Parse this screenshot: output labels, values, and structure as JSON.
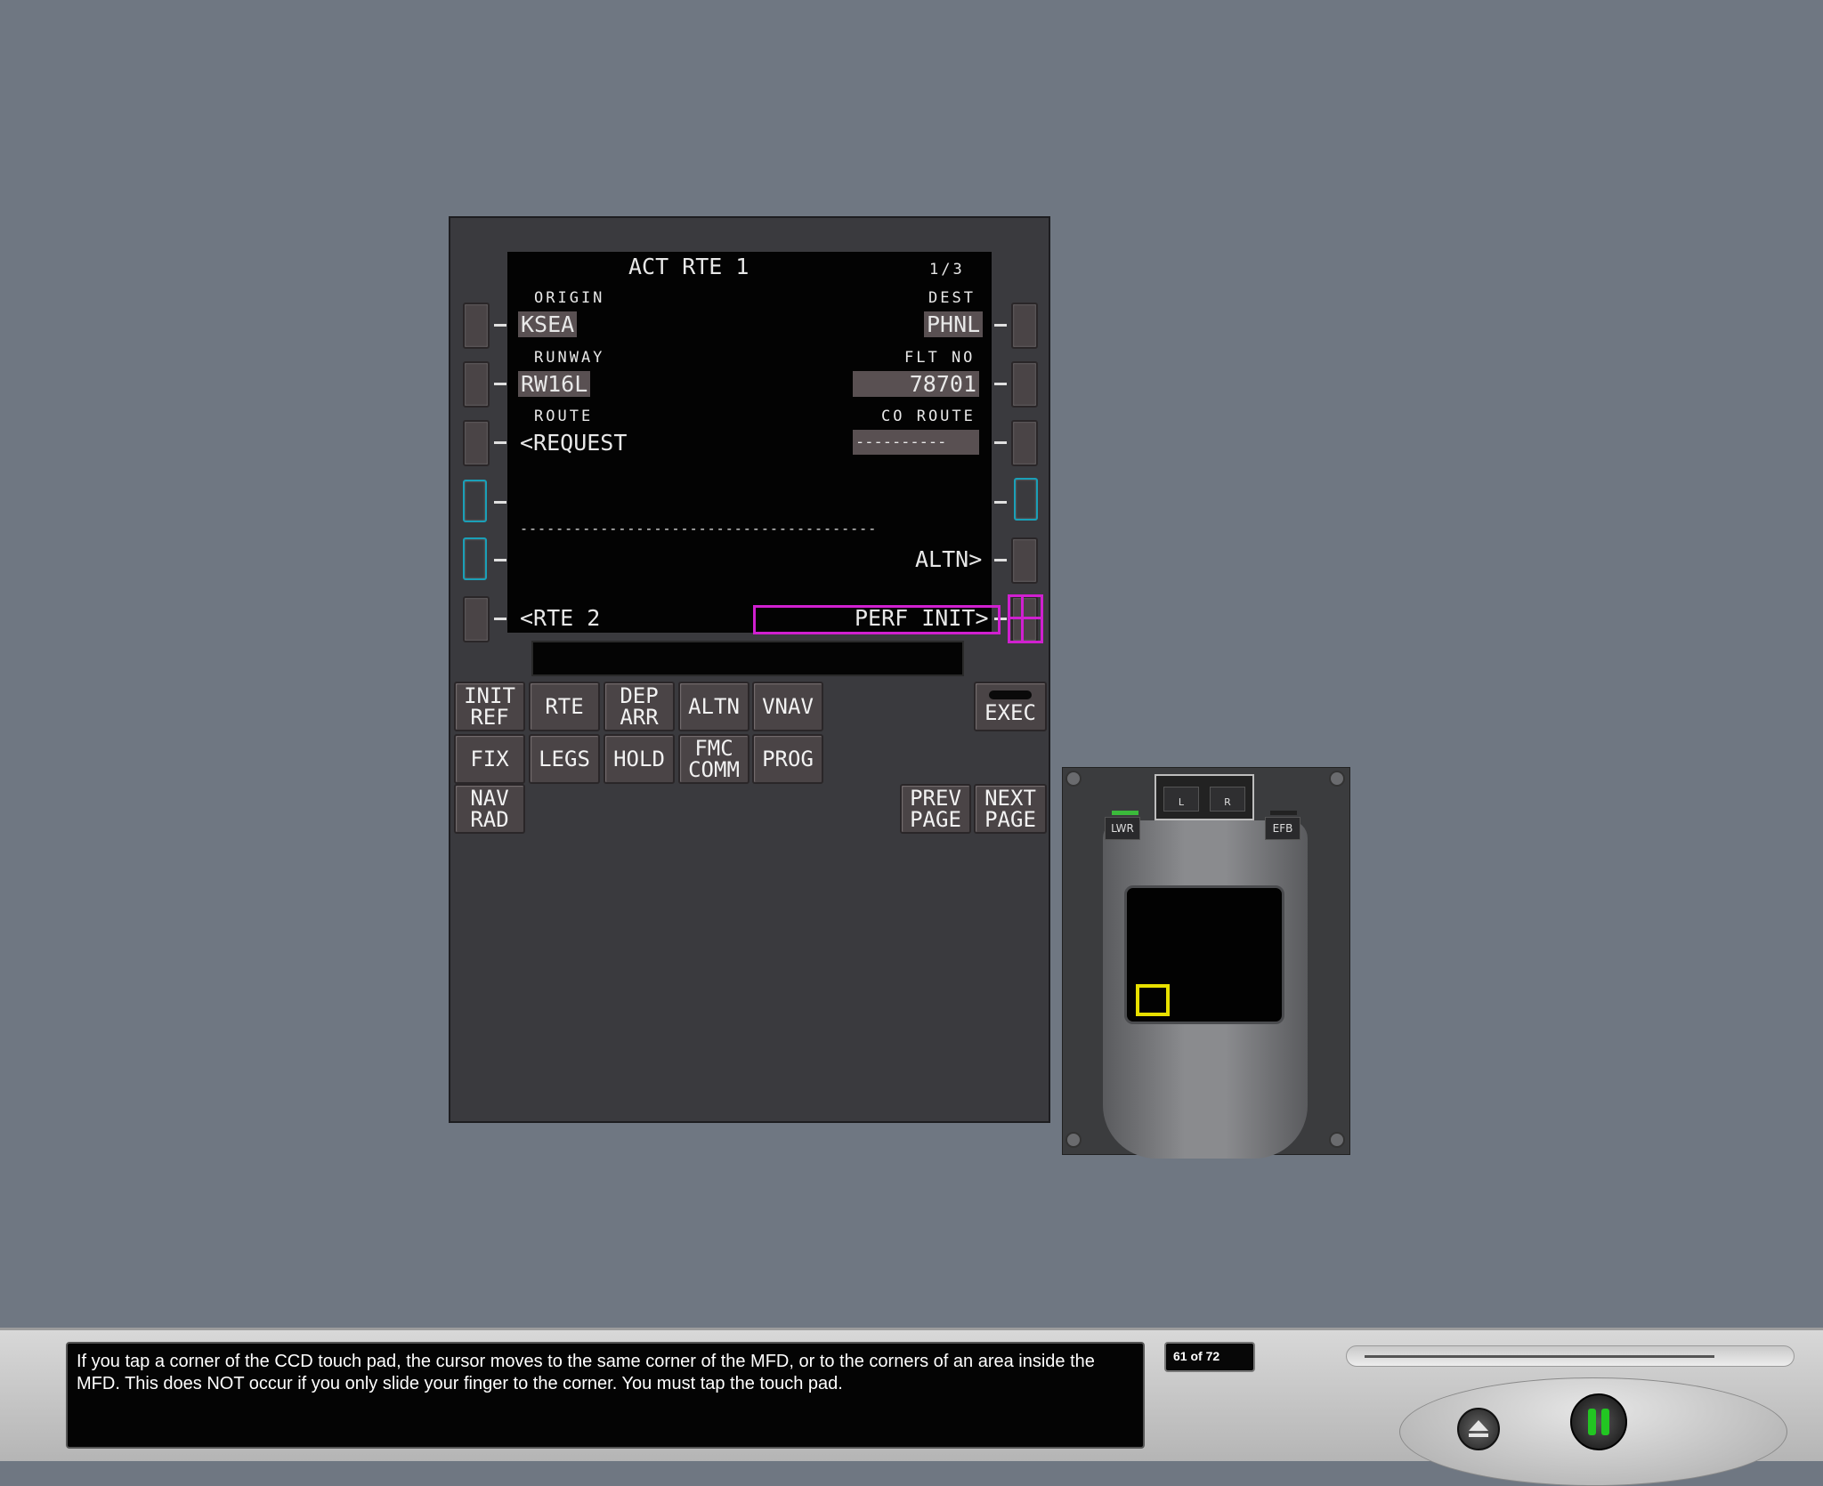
{
  "cdu": {
    "screen": {
      "title": "ACT RTE 1",
      "page": "1/3",
      "l1_label": "ORIGIN",
      "l1_value": "KSEA",
      "r1_label": "DEST",
      "r1_value": "PHNL",
      "l2_label": "RUNWAY",
      "l2_value": "RW16L",
      "r2_label": "FLT NO",
      "r2_value": "78701",
      "l3_label": "ROUTE",
      "l3_value": "<REQUEST",
      "r3_label": "CO ROUTE",
      "r3_value": "----------",
      "divider": "----------------------------------------",
      "r5_value": "ALTN>",
      "l6_value": "<RTE 2",
      "r6_value": "PERF INIT>"
    },
    "keys": {
      "init_ref": "INIT\nREF",
      "rte": "RTE",
      "dep_arr": "DEP\nARR",
      "altn": "ALTN",
      "vnav": "VNAV",
      "fix": "FIX",
      "legs": "LEGS",
      "hold": "HOLD",
      "fmc_comm": "FMC\nCOMM",
      "prog": "PROG",
      "nav_rad": "NAV\nRAD",
      "exec": "EXEC",
      "prev_page": "PREV\nPAGE",
      "next_page": "NEXT\nPAGE"
    }
  },
  "ccd": {
    "l_label": "L",
    "r_label": "R",
    "lwr_label": "LWR",
    "efb_label": "EFB"
  },
  "player": {
    "caption": "If you tap a corner of the CCD touch pad, the cursor moves to the same corner of the MFD, or to the corners of an area inside the MFD. This does NOT occur if you only slide your finger to the corner. You must tap the touch pad.",
    "page_counter": "61 of 72",
    "progress_fraction": 0.847
  },
  "colors": {
    "highlight": "#d020d0",
    "cursor": "#e8e000",
    "play_green": "#22c622",
    "cyan_key": "#1aa0b8"
  }
}
